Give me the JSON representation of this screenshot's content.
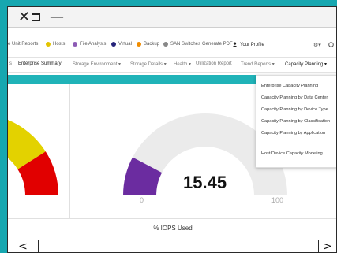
{
  "colors": {
    "accent_teal": "#20b3b8",
    "background_teal": "#16a7b0",
    "gauge_purple": "#6b2ca0",
    "gauge_track": "#ebebeb",
    "gauge_yellow": "#e3d200",
    "gauge_red": "#e10000"
  },
  "window": {
    "close_glyph": "✕",
    "minimize_glyph": "—"
  },
  "topnav": {
    "items": [
      {
        "label": "e Unit Reports"
      },
      {
        "label": "Hosts",
        "dot": "#e3c400"
      },
      {
        "label": "File Analysis",
        "dot": "#8d5bb5"
      },
      {
        "label": "Virtual",
        "dot": "#25237a"
      },
      {
        "label": "Backup",
        "dot": "#f08c00"
      },
      {
        "label": "SAN Switches",
        "dot": "#888888"
      },
      {
        "label": "Generate PDF"
      },
      {
        "label": "Your Profile",
        "icon": "user-icon"
      }
    ],
    "settings_icon": "gear-icon",
    "help_icon": "help-icon"
  },
  "menubar": {
    "items": [
      {
        "label": "s"
      },
      {
        "label": "Enterprise Summary"
      },
      {
        "label": "Storage Environment ▾"
      },
      {
        "label": "Storage Details ▾"
      },
      {
        "label": "Health ▾"
      },
      {
        "label": "Utilization Report"
      },
      {
        "label": "Trend Reports ▾"
      },
      {
        "label": "Capacity Planning ▾"
      }
    ]
  },
  "dropdown": {
    "items": [
      "Enterprise Capacity Planning",
      "Capacity Planning by Data Center",
      "Capacity Planning by Device Type",
      "Capacity Planning by Classification",
      "Capacity Planning by Application",
      "Host/Device Capacity Modeling"
    ]
  },
  "gauge": {
    "value_label": "15.45",
    "value": 15.45,
    "min_label": "0",
    "max_label": "100",
    "caption": "% IOPS Used"
  },
  "scrollbar": {
    "left_arrow": "<",
    "right_arrow": ">"
  }
}
